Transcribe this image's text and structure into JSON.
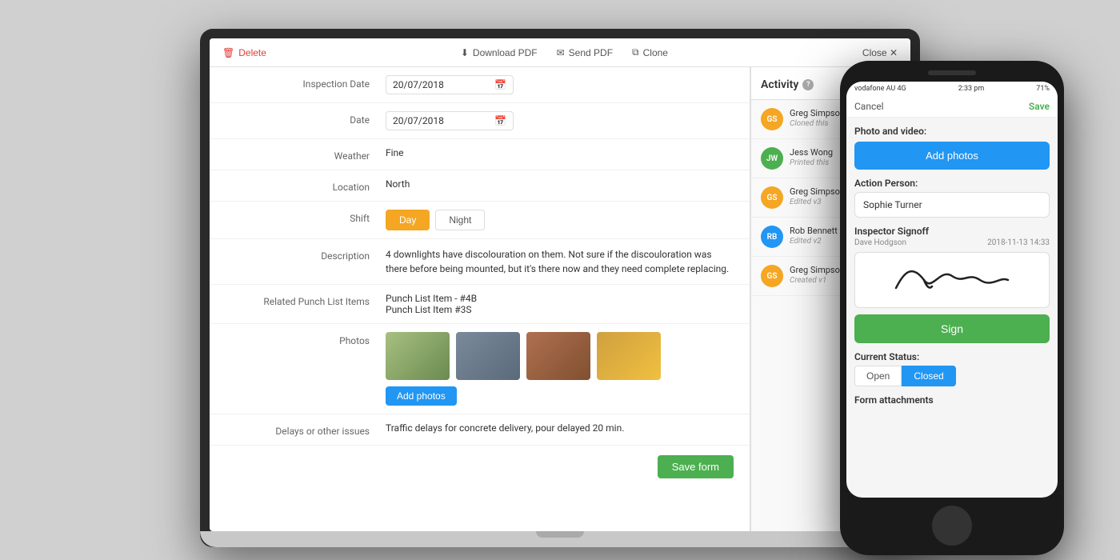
{
  "toolbar": {
    "delete_label": "Delete",
    "download_pdf_label": "Download PDF",
    "send_pdf_label": "Send PDF",
    "clone_label": "Clone",
    "close_label": "Close"
  },
  "form": {
    "inspection_date_label": "Inspection Date",
    "inspection_date_value": "20/07/2018",
    "date_label": "Date",
    "date_value": "20/07/2018",
    "weather_label": "Weather",
    "weather_value": "Fine",
    "location_label": "Location",
    "location_value": "North",
    "shift_label": "Shift",
    "shift_day": "Day",
    "shift_night": "Night",
    "description_label": "Description",
    "description_value": "4 downlights have discolouration on them. Not sure if the discouloration was there before being mounted, but it's there now and they need complete replacing.",
    "related_label": "Related Punch List Items",
    "related_item1": "Punch List Item - #4B",
    "related_item2": "Punch List Item #3S",
    "photos_label": "Photos",
    "add_photos_label": "Add photos",
    "delays_label": "Delays or other issues",
    "delays_value": "Traffic delays for concrete delivery, pour delayed 20 min.",
    "save_form_label": "Save form"
  },
  "activity": {
    "title": "Activity",
    "items": [
      {
        "initials": "GS",
        "name": "Greg Simpson",
        "action": "Cloned this",
        "avatar_color": "orange"
      },
      {
        "initials": "JW",
        "name": "Jess Wong",
        "action": "Printed this",
        "avatar_color": "green"
      },
      {
        "initials": "GS",
        "name": "Greg Simpson",
        "action": "Edited v3",
        "avatar_color": "orange"
      },
      {
        "initials": "RB",
        "name": "Rob Bennett",
        "action": "Edited v2",
        "avatar_color": "blue"
      },
      {
        "initials": "GS",
        "name": "Greg Simpson",
        "action": "Created v1",
        "avatar_color": "orange"
      }
    ]
  },
  "phone": {
    "status_bar": {
      "carrier": "vodafone AU 4G",
      "time": "2:33 pm",
      "battery": "71%"
    },
    "cancel_label": "Cancel",
    "save_label": "Save",
    "photo_section_title": "Photo and video:",
    "add_photos_label": "Add photos",
    "action_person_label": "Action Person:",
    "action_person_value": "Sophie Turner",
    "inspector_signoff_label": "Inspector Signoff",
    "signoff_name": "Dave Hodgson",
    "signoff_date": "2018-11-13 14:33",
    "sign_label": "Sign",
    "current_status_label": "Current Status:",
    "status_open": "Open",
    "status_closed": "Closed",
    "form_attachments_label": "Form attachments"
  }
}
